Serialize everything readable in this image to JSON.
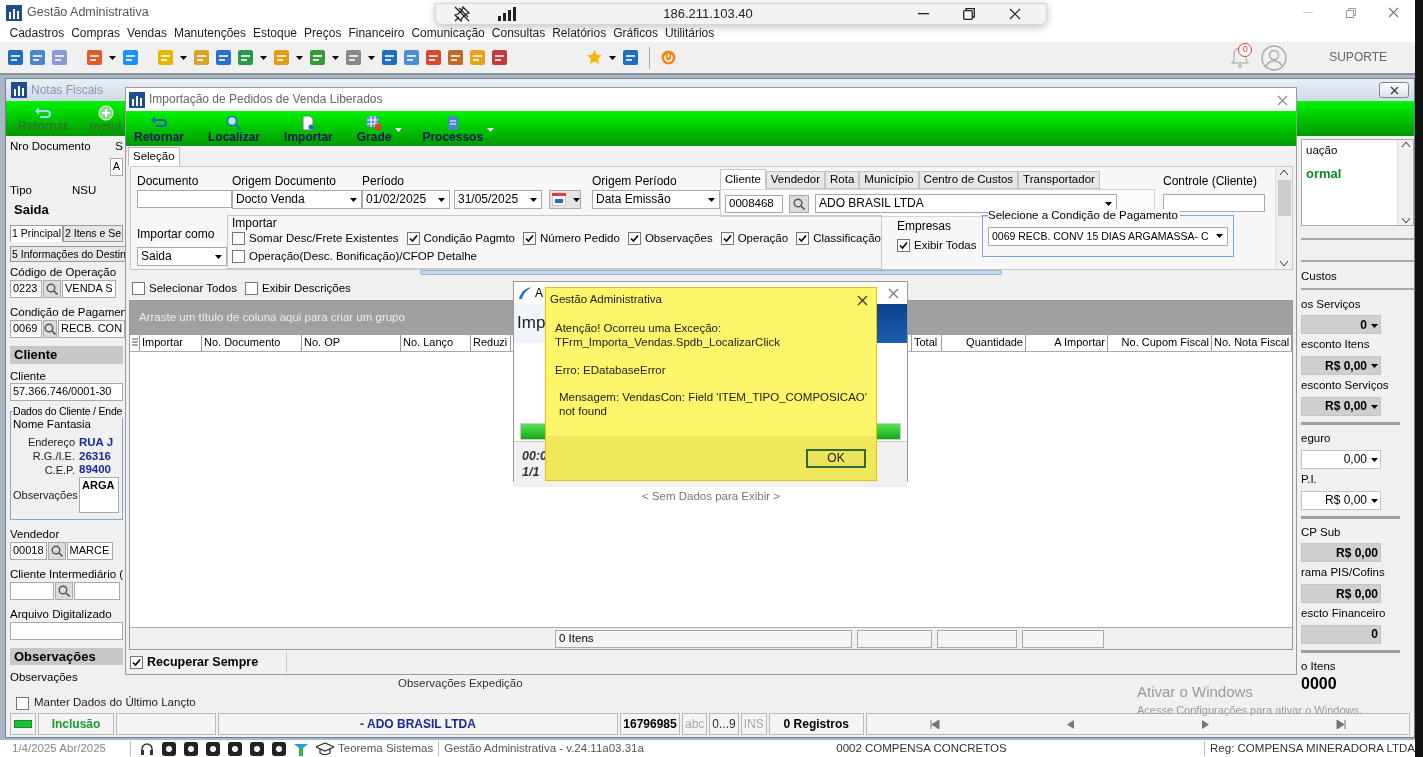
{
  "app": {
    "title": "Gestão Administrativa",
    "menu": [
      "Cadastros",
      "Compras",
      "Vendas",
      "Manutenções",
      "Estoque",
      "Preços",
      "Financeiro",
      "Comunicação",
      "Consultas",
      "Relatórios",
      "Gráficos",
      "Utilitários"
    ],
    "notification_count": "0",
    "user": "SUPORTE"
  },
  "remote_bar": {
    "address": "186.211.103.40"
  },
  "notas_window": {
    "title": "Notas Fiscais",
    "toolbar": [
      {
        "label": "Retornar",
        "disabled": true
      },
      {
        "label": "Inclui",
        "disabled": true
      }
    ],
    "header": {
      "nro_documento_label": "Nro Documento",
      "serie_label": "S",
      "serie_value": "A",
      "tipo_label": "Tipo",
      "nsu_label": "NSU",
      "tipo_value": "Saida"
    },
    "tabs": [
      {
        "label": "1 Principal",
        "selected": true
      },
      {
        "label": "2 Itens e Se",
        "selected": false
      },
      {
        "label": "5 Informações do Destin",
        "selected": false
      }
    ],
    "left_rows": [
      {
        "kind": "label",
        "text": "Código de Operação"
      },
      {
        "kind": "lookup",
        "code": "0223",
        "value": "VENDA S"
      },
      {
        "kind": "label",
        "text": "Condição de Pagamen"
      },
      {
        "kind": "lookup",
        "code": "0069",
        "value": "RECB. CON"
      },
      {
        "kind": "header",
        "text": "Cliente"
      },
      {
        "kind": "label",
        "text": "Cliente"
      },
      {
        "kind": "field",
        "value": "57.366.746/0001-30"
      },
      {
        "kind": "group",
        "title": "Dados do Cliente / Ende",
        "caption": "Nome Fantasia",
        "pairs": [
          {
            "label": "Endereço",
            "value": "RUA J"
          },
          {
            "label": "R.G./I.E.",
            "value": "26316"
          },
          {
            "label": "C.E.P.",
            "value": "89400"
          }
        ],
        "notes_label": "Observações",
        "notes": "ARGA"
      },
      {
        "kind": "label",
        "text": "Vendedor"
      },
      {
        "kind": "lookup",
        "code": "00018",
        "value": "MARCE"
      },
      {
        "kind": "label",
        "text": "Cliente Intermediário ("
      },
      {
        "kind": "lookup"
      },
      {
        "kind": "label",
        "text": "Arquivo Digitalizado"
      },
      {
        "kind": "field"
      },
      {
        "kind": "header",
        "text": "Observações"
      },
      {
        "kind": "label",
        "text": "Observações"
      }
    ],
    "right_top": {
      "label": "uação",
      "value": "ormal"
    },
    "right_tab": "Custos",
    "right_rows": [
      {
        "kind": "label",
        "text": "os Serviços"
      },
      {
        "kind": "field",
        "value": "0",
        "shaded": true,
        "dropdown": true
      },
      {
        "kind": "label",
        "text": "esconto Itens"
      },
      {
        "kind": "field",
        "value": "R$ 0,00",
        "shaded": true,
        "dropdown": true
      },
      {
        "kind": "label",
        "text": "esconto Serviços"
      },
      {
        "kind": "field",
        "value": "R$ 0,00",
        "shaded": true,
        "dropdown": true
      },
      {
        "kind": "rule"
      },
      {
        "kind": "label",
        "text": "eguro"
      },
      {
        "kind": "field",
        "value": "0,00",
        "shaded": false,
        "dropdown": true
      },
      {
        "kind": "label",
        "text": "P.I."
      },
      {
        "kind": "field",
        "value": "R$ 0,00",
        "shaded": false,
        "dropdown": true
      },
      {
        "kind": "rule"
      },
      {
        "kind": "label",
        "text": "CP Sub"
      },
      {
        "kind": "field",
        "value": "R$ 0,00",
        "shaded": true,
        "dropdown": false
      },
      {
        "kind": "label",
        "text": "rama PIS/Cofins"
      },
      {
        "kind": "field",
        "value": "R$ 0,00",
        "shaded": true,
        "dropdown": false
      },
      {
        "kind": "label",
        "text": "escto Financeiro"
      },
      {
        "kind": "field",
        "value": "0",
        "shaded": true,
        "dropdown": false
      },
      {
        "kind": "rule"
      },
      {
        "kind": "label",
        "text": "o Itens"
      },
      {
        "kind": "total",
        "value": "0000"
      }
    ],
    "observacoes_expedicao": "Observações Expedição",
    "keep_data": {
      "label": "Manter Dados do Último Lançto",
      "checked": false
    }
  },
  "import_dialog": {
    "title": "Importação de Pedidos de Venda Liberados",
    "toolbar": [
      {
        "label": "Retornar",
        "menu": false
      },
      {
        "label": "Localizar",
        "menu": false
      },
      {
        "label": "Importar",
        "menu": false
      },
      {
        "label": "Grade",
        "menu": true
      },
      {
        "label": "Processos",
        "menu": true
      }
    ],
    "tab": "Seleção",
    "documento": {
      "label": "Documento"
    },
    "origem_documento": {
      "label": "Origem Documento",
      "value": "Docto Venda"
    },
    "periodo": {
      "label": "Período",
      "start": "01/02/2025",
      "end": "31/05/2025"
    },
    "origem_periodo": {
      "label": "Origem Período",
      "value": "Data Emissão"
    },
    "filter_tabs": [
      {
        "label": "Cliente",
        "selected": true
      },
      {
        "label": "Vendedor",
        "selected": false
      },
      {
        "label": "Rota",
        "selected": false
      },
      {
        "label": "Município",
        "selected": false
      },
      {
        "label": "Centro de Custos",
        "selected": false
      },
      {
        "label": "Transportador",
        "selected": false
      }
    ],
    "client_code": "0008468",
    "client_name": "ADO BRASIL LTDA",
    "controle": {
      "label": "Controle (Cliente)"
    },
    "importar_como": {
      "label": "Importar como",
      "value": "Saida"
    },
    "importar": {
      "title": "Importar",
      "options": [
        {
          "label": "Somar Desc/Frete Existentes",
          "checked": false
        },
        {
          "label": "Condição Pagmto",
          "checked": true
        },
        {
          "label": "Número Pedido",
          "checked": true
        },
        {
          "label": "Observações",
          "checked": true
        },
        {
          "label": "Operação",
          "checked": true
        },
        {
          "label": "Classificação",
          "checked": true
        },
        {
          "label": "Operação(Desc. Bonificação)/CFOP Detalhe",
          "checked": false
        }
      ]
    },
    "empresas": {
      "label": "Empresas",
      "option": {
        "label": "Exibir Todas",
        "checked": true
      }
    },
    "condicao": {
      "title": "Selecione a Condição de Pagamento",
      "value": "0069 RECB. CONV 15 DIAS ARGAMASSA- C"
    },
    "grid_options": [
      {
        "label": "Selecionar Todos",
        "checked": false
      },
      {
        "label": "Exibir Descrições",
        "checked": false
      }
    ],
    "group_hint": "Arraste um título de coluna aqui para criar um grupo",
    "columns": [
      "Importar",
      "No. Documento",
      "No. OP",
      "No. Lanço",
      "Reduzi",
      "Total",
      "Quantidade",
      "A Importar",
      "No. Cupom Fiscal",
      "No. Nota Fiscal"
    ],
    "empty_text": "< Sem Dados para Exibir >",
    "item_count": "0 Itens",
    "recuperar": {
      "label": "Recuperar Sempre",
      "checked": true
    }
  },
  "progress_window": {
    "title": "A",
    "heading": "Imp",
    "level": 1,
    "elapsed": "00:0",
    "count": "1/1"
  },
  "error_dialog": {
    "title": "Gestão Administrativa",
    "paragraphs": [
      [
        "Atenção! Ocorreu uma Exceção:",
        "TFrm_Importa_Vendas.Spdb_LocalizarClick"
      ],
      [
        "Erro: EDatabaseError"
      ],
      [
        "Mensagem: VendasCon: Field 'ITEM_TIPO_COMPOSICAO' not found"
      ]
    ],
    "button": "OK"
  },
  "status_bar": {
    "mode": "Inclusão",
    "client": "- ADO BRASIL LTDA",
    "number": "16796985",
    "indicators": [
      {
        "label": "abc",
        "on": false
      },
      {
        "label": "0...9",
        "on": true
      },
      {
        "label": "INS",
        "on": false
      }
    ],
    "records": "0 Registros"
  },
  "footer": {
    "date": "1/4/2025 Abr/2025",
    "company_link": "Teorema Sistemas",
    "version": "Gestão Administrativa - v.24.11a03.31a",
    "company": "0002 COMPENSA CONCRETOS",
    "registration": "Reg: COMPENSA MINERADORA LTDA"
  },
  "windows_notice": {
    "title": "Ativar o Windows",
    "text": "Acesse Configurações para ativar o Windows."
  }
}
